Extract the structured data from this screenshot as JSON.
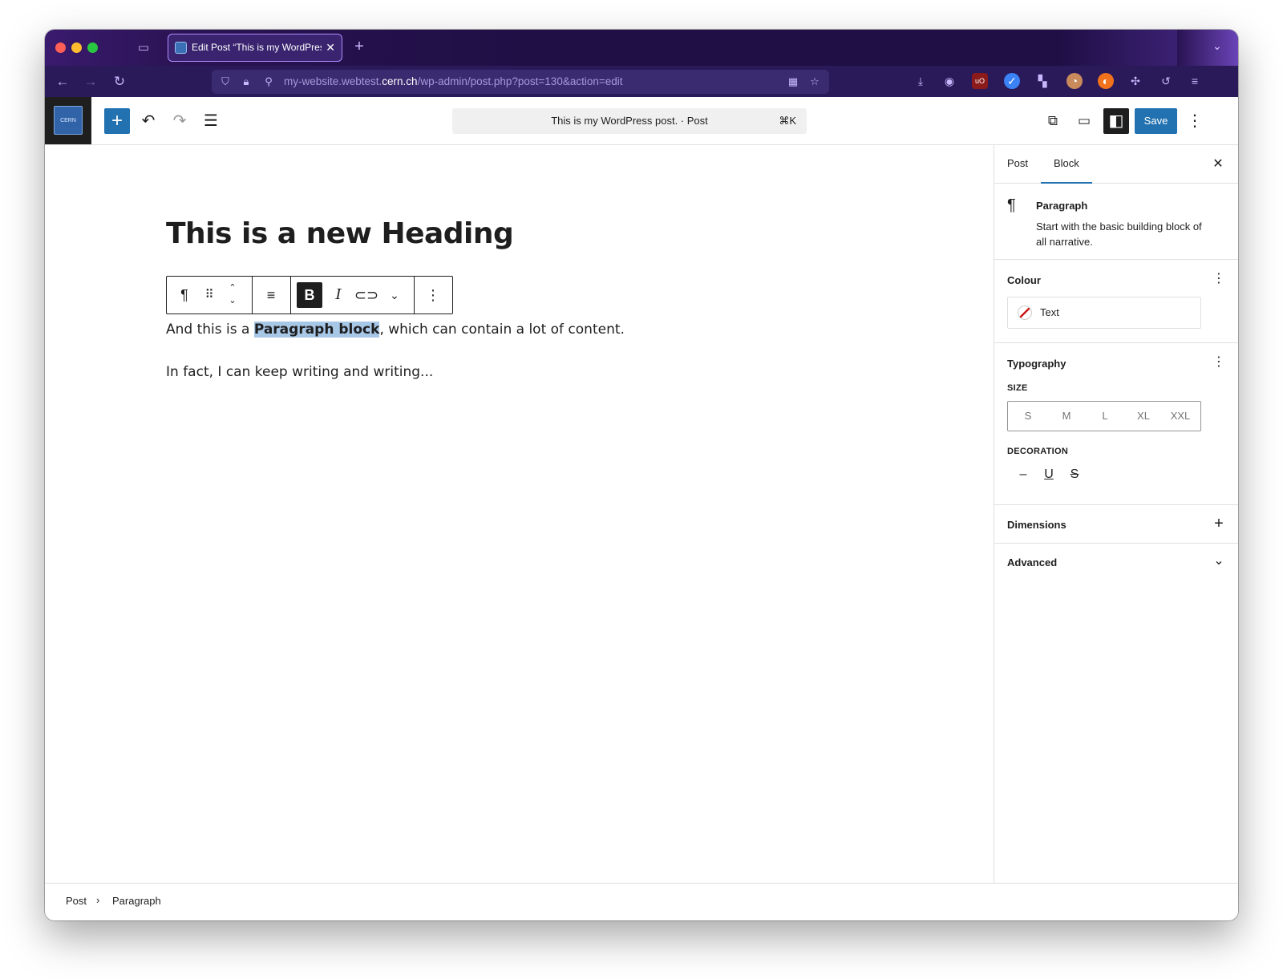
{
  "browser": {
    "tab_title": "Edit Post “This is my WordPress post.”",
    "url_host_prefix": "my-website.webtest.",
    "url_host_domain": "cern.ch",
    "url_path": "/wp-admin/post.php?post=130&action=edit"
  },
  "header": {
    "logo_text": "CERN",
    "command_bar": "This is my WordPress post. · Post",
    "command_shortcut": "⌘K",
    "save_label": "Save"
  },
  "canvas": {
    "heading": "This is a new Heading",
    "paragraph1_before": "And this is a ",
    "paragraph1_selected": "Paragraph block",
    "paragraph1_after": ", which can contain a lot of content.",
    "paragraph2": "In fact, I can keep writing and writing..."
  },
  "block_toolbar": {
    "bold": "B",
    "italic": "I"
  },
  "sidebar": {
    "tabs": [
      {
        "label": "Post"
      },
      {
        "label": "Block"
      }
    ],
    "active_tab": "Block",
    "block_card": {
      "title": "Paragraph",
      "description": "Start with the basic building block of all narrative."
    },
    "colour": {
      "title": "Colour",
      "items": [
        {
          "label": "Text"
        }
      ]
    },
    "typography": {
      "title": "Typography",
      "size_label": "SIZE",
      "sizes": [
        "S",
        "M",
        "L",
        "XL",
        "XXL"
      ],
      "decoration_label": "DECORATION"
    },
    "dimensions": {
      "title": "Dimensions"
    },
    "advanced": {
      "title": "Advanced"
    }
  },
  "breadcrumbs": [
    "Post",
    "Paragraph"
  ],
  "colors": {
    "accent": "#2271b1",
    "selection": "#a7c7e7",
    "browser_bg": "#1f0f45"
  }
}
